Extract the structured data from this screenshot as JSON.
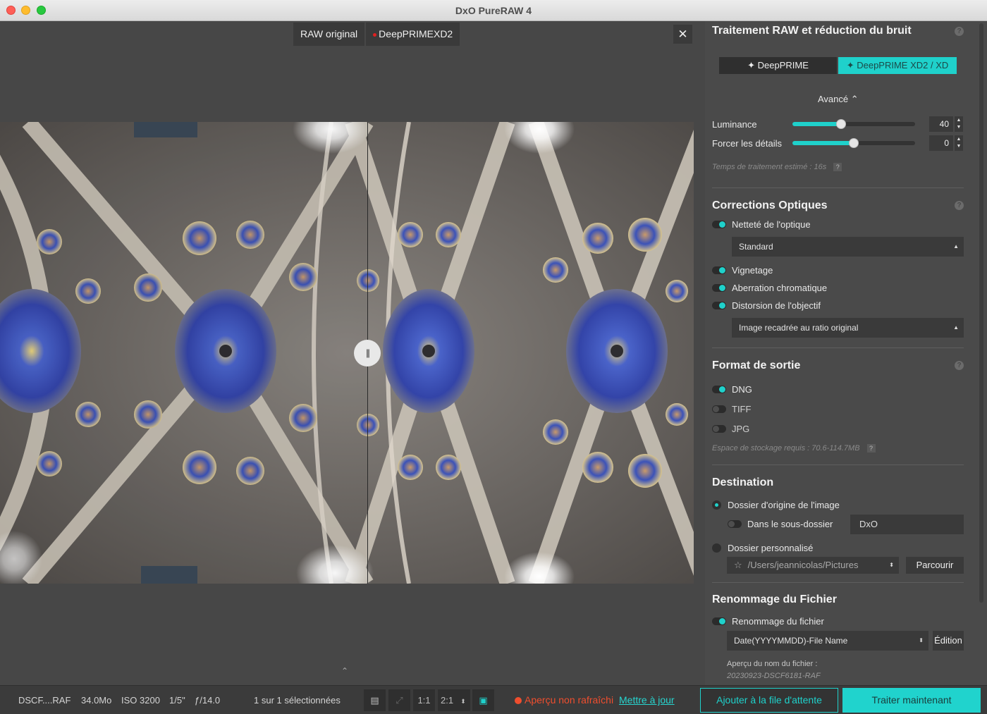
{
  "window": {
    "title": "DxO PureRAW 4"
  },
  "viewer": {
    "tab_original": "RAW original",
    "tab_processed": "DeepPRIMEXD2",
    "close": "✕",
    "split_handle": "|||",
    "expand": "⌃"
  },
  "raw_section": {
    "title": "Traitement RAW et réduction du bruit",
    "help": "?",
    "mode_a": "✦ DeepPRIME",
    "mode_b": "✦ DeepPRIME XD2 / XD",
    "advanced": "Avancé ⌃",
    "luminance_label": "Luminance",
    "luminance_value": "40",
    "luminance_level": 0.4,
    "details_label": "Forcer les détails",
    "details_value": "0",
    "details_level": 0.5,
    "estimate": "Temps de traitement estimé :  16s",
    "estimate_help": "?"
  },
  "optics": {
    "title": "Corrections Optiques",
    "help": "?",
    "sharpness": "Netteté de l'optique",
    "sharpness_select": "Standard",
    "vignetting": "Vignetage",
    "chromatic": "Aberration chromatique",
    "distortion": "Distorsion de l'objectif",
    "distortion_select": "Image recadrée au ratio original"
  },
  "output": {
    "title": "Format de sortie",
    "help": "?",
    "dng": "DNG",
    "tiff": "TIFF",
    "jpg": "JPG",
    "storage": "Espace de stockage requis : 70.6-114.7MB",
    "storage_help": "?"
  },
  "destination": {
    "title": "Destination",
    "origin_folder": "Dossier d'origine de l'image",
    "subfolder": "Dans le sous-dossier",
    "subfolder_value": "DxO",
    "custom_folder": "Dossier personnalisé",
    "path": "/Users/jeannicolas/Pictures",
    "browse": "Parcourir"
  },
  "rename": {
    "title": "Renommage du Fichier",
    "toggle_label": "Renommage du fichier",
    "pattern": "Date(YYYYMMDD)-File Name",
    "edit": "Édition",
    "preview_label": "Aperçu du nom du fichier :",
    "preview_value": "20230923-DSCF6181-RAF"
  },
  "statusbar": {
    "filename": "DSCF....RAF",
    "size": "34.0Mo",
    "iso": "ISO 3200",
    "shutter": "1/5\"",
    "aperture": "ƒ/14.0",
    "selection": "1 sur 1 sélectionnées",
    "zoom_1": "1:1",
    "zoom_2": "2:1",
    "warning": "Aperçu non rafraîchi",
    "update": "Mettre à jour",
    "queue": "Ajouter à la file d'attente",
    "process": "Traiter maintenant"
  },
  "colors": {
    "accent": "#1fd1cb",
    "warning": "#f04e2e"
  }
}
